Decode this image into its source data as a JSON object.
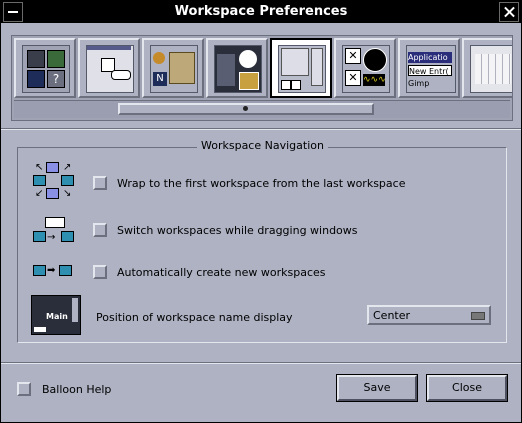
{
  "window": {
    "title": "Workspace Preferences"
  },
  "toolbar": {
    "items": [
      {
        "name": "general"
      },
      {
        "name": "keyboard-focus"
      },
      {
        "name": "applications"
      },
      {
        "name": "decorations"
      },
      {
        "name": "workspaces",
        "active": true
      },
      {
        "name": "sounds"
      },
      {
        "name": "menus",
        "texts": [
          "Applicatio",
          "New Entr(",
          "Gimp"
        ]
      },
      {
        "name": "keyboard"
      }
    ]
  },
  "group": {
    "title": "Workspace Navigation"
  },
  "options": {
    "wrap": {
      "label": "Wrap to the first workspace from the last workspace",
      "checked": false
    },
    "switch_drag": {
      "label": "Switch workspaces while dragging windows",
      "checked": false
    },
    "auto_create": {
      "label": "Automatically create new workspaces",
      "checked": false
    }
  },
  "name_display": {
    "label": "Position of workspace name display",
    "icon_text": "Main",
    "value": "Center"
  },
  "footer": {
    "balloon_help": {
      "label": "Balloon Help",
      "checked": false
    },
    "save_label": "Save",
    "close_label": "Close"
  },
  "colors": {
    "background": "#aeb2c3",
    "title_bar": "#000000",
    "title_text": "#ffffff"
  }
}
